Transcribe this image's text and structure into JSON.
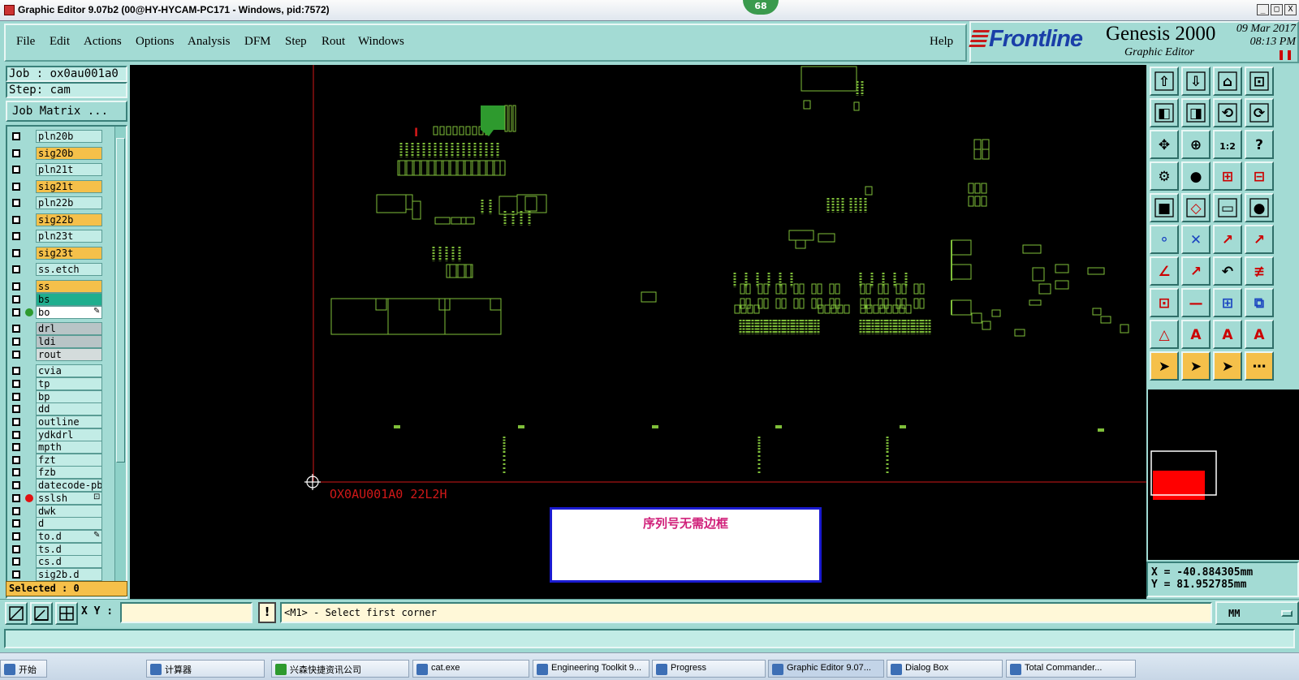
{
  "window": {
    "title": "Graphic Editor 9.07b2 (00@HY-HYCAM-PC171 - Windows, pid:7572)",
    "badge": "68",
    "controls": [
      "_",
      "□",
      "X"
    ]
  },
  "menubar": {
    "items": [
      "File",
      "Edit",
      "Actions",
      "Options",
      "Analysis",
      "DFM",
      "Step",
      "Rout",
      "Windows"
    ],
    "help": "Help"
  },
  "brand": {
    "logo": "Frontline",
    "product": "Genesis 2000",
    "subtitle": "Graphic Editor",
    "date": "09 Mar 2017",
    "time": "08:13 PM",
    "colors": {
      "logo": "#1a3fa8",
      "stripes": "#c61a1a"
    }
  },
  "job": {
    "job_label": "Job  : ox0au001a0",
    "step_label": "Step: cam",
    "matrix_button": "Job Matrix ..."
  },
  "layers": [
    {
      "name": "pln20b",
      "color": "#c2ece6",
      "dot": ""
    },
    {
      "name": "sig20b",
      "color": "#f5c04a",
      "dot": ""
    },
    {
      "name": "pln21t",
      "color": "#c2ece6",
      "dot": ""
    },
    {
      "name": "sig21t",
      "color": "#f5c04a",
      "dot": ""
    },
    {
      "name": "pln22b",
      "color": "#c2ece6",
      "dot": ""
    },
    {
      "name": "sig22b",
      "color": "#f5c04a",
      "dot": ""
    },
    {
      "name": "pln23t",
      "color": "#c2ece6",
      "dot": ""
    },
    {
      "name": "sig23t",
      "color": "#f5c04a",
      "dot": ""
    },
    {
      "name": "ss.etch",
      "color": "#c2ece6",
      "dot": ""
    },
    {
      "name": "ss",
      "color": "#f5c04a",
      "dot": ""
    },
    {
      "name": "bs",
      "color": "#1fae8e",
      "dot": ""
    },
    {
      "name": "bo",
      "color": "#ffffff",
      "dot": "#2e9a2e",
      "mark": "✎"
    },
    {
      "name": "drl",
      "color": "#b8c4c6",
      "dot": ""
    },
    {
      "name": "ldi",
      "color": "#b8c4c6",
      "dot": ""
    },
    {
      "name": "rout",
      "color": "#d4dcdc",
      "dot": ""
    },
    {
      "name": "cvia",
      "color": "#c2ece6",
      "dot": ""
    },
    {
      "name": "tp",
      "color": "#c2ece6",
      "dot": ""
    },
    {
      "name": "bp",
      "color": "#c2ece6",
      "dot": ""
    },
    {
      "name": "dd",
      "color": "#c2ece6",
      "dot": ""
    },
    {
      "name": "outline",
      "color": "#c2ece6",
      "dot": ""
    },
    {
      "name": "ydkdrl",
      "color": "#c2ece6",
      "dot": ""
    },
    {
      "name": "mpth",
      "color": "#c2ece6",
      "dot": ""
    },
    {
      "name": "fzt",
      "color": "#c2ece6",
      "dot": ""
    },
    {
      "name": "fzb",
      "color": "#c2ece6",
      "dot": ""
    },
    {
      "name": "datecode-pb",
      "color": "#c2ece6",
      "dot": ""
    },
    {
      "name": "sslsh",
      "color": "#c2ece6",
      "dot": "#e01010",
      "mark": "⊡"
    },
    {
      "name": "dwk",
      "color": "#c2ece6",
      "dot": ""
    },
    {
      "name": "d",
      "color": "#c2ece6",
      "dot": ""
    },
    {
      "name": "to.d",
      "color": "#c2ece6",
      "dot": "",
      "mark": "✎"
    },
    {
      "name": "ts.d",
      "color": "#c2ece6",
      "dot": ""
    },
    {
      "name": "cs.d",
      "color": "#c2ece6",
      "dot": ""
    },
    {
      "name": "sig2b.d",
      "color": "#c2ece6",
      "dot": ""
    }
  ],
  "selected": "Selected : 0",
  "canvas": {
    "serial_text": "OX0AU001A0 22L2H",
    "note": "序列号无需边框",
    "red_marker": "I",
    "colors": {
      "copper": "#7fbf3a",
      "axis": "#d01818",
      "text": "#d01818"
    }
  },
  "toolbox": {
    "icons": [
      "pan-up-icon",
      "pan-down-icon",
      "home-icon",
      "zoom-window-icon",
      "pan-left-icon",
      "pan-right-icon",
      "zoom-back-icon",
      "redraw-icon",
      "zoom-fit-icon",
      "zoom-center-icon",
      "scale-1-2-icon",
      "help-icon",
      "snap-settings-icon",
      "measure-icon",
      "net-connect-icon",
      "net-grid-icon",
      "pad-icon",
      "rotate-icon",
      "ruler-icon",
      "record-icon",
      "connect-icon",
      "cross-icon",
      "arrow-node-icon",
      "arrow-up-node-icon",
      "line-angle-icon",
      "line-arrow-icon",
      "undo-arc-icon",
      "fence-icon",
      "add-pad-icon",
      "minus-icon",
      "align-icon",
      "group-icon",
      "triangle-select-icon",
      "triangle-a-icon",
      "text-a-icon",
      "text-ab-icon",
      "pointer-icon",
      "pointer-box-icon",
      "pointer-circle-icon",
      "node-pointer-icon"
    ]
  },
  "coords": {
    "x": "X  =  -40.884305mm",
    "y": "Y  =  81.952785mm"
  },
  "bottom": {
    "xy_label": "X Y :",
    "xy_value": "",
    "warn": "!",
    "prompt": "<M1> - Select first corner",
    "units": "MM"
  },
  "taskbar": {
    "items": [
      "开始",
      "计算器",
      "兴森快捷资讯公司",
      "cat.exe",
      "Engineering Toolkit 9...",
      "Progress",
      "Graphic Editor 9.07...",
      "Dialog Box",
      "Total Commander..."
    ]
  }
}
